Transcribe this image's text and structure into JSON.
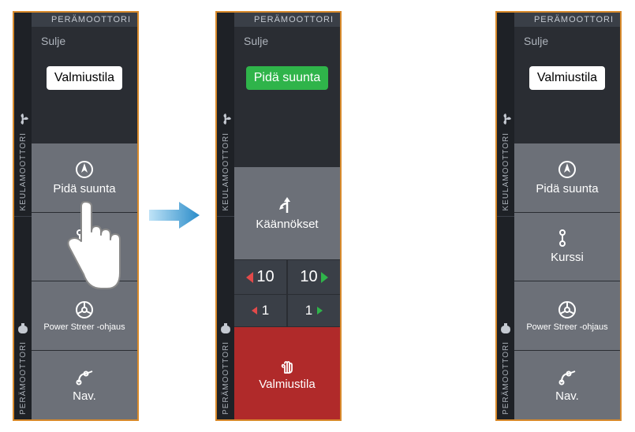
{
  "header": "PERÄMOOTTORI",
  "close": "Sulje",
  "sidebar": {
    "top": "KEULAMOOTTORI",
    "bottom": "PERÄMOOTTORI"
  },
  "p1": {
    "pill": "Valmiustila",
    "b1": "Pidä suunta",
    "b2": "K",
    "b3": "Power Streer -ohjaus",
    "b4": "Nav."
  },
  "p2": {
    "pill": "Pidä suunta",
    "turns": "Käännökset",
    "big": "10",
    "small": "1",
    "standby": "Valmiustila"
  },
  "p3": {
    "pill": "Valmiustila",
    "b1": "Pidä suunta",
    "b2": "Kurssi",
    "b3": "Power Streer -ohjaus",
    "b4": "Nav."
  }
}
